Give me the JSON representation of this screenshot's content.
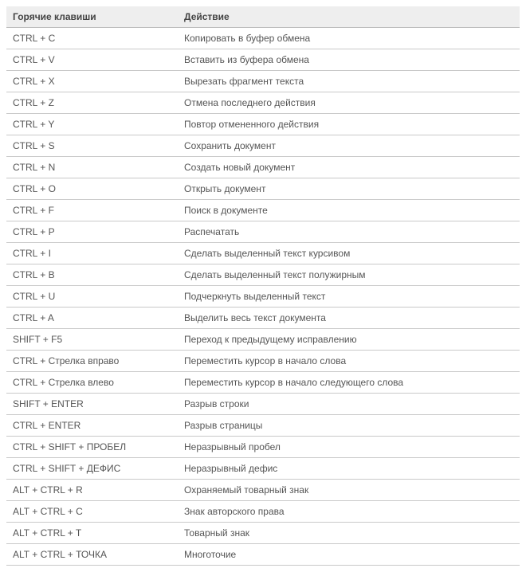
{
  "table": {
    "headers": {
      "hotkey": "Горячие клавиши",
      "action": "Действие"
    },
    "rows": [
      {
        "hotkey": "CTRL + C",
        "action": "Копировать в буфер обмена"
      },
      {
        "hotkey": "CTRL + V",
        "action": "Вставить из буфера обмена"
      },
      {
        "hotkey": "CTRL + X",
        "action": "Вырезать фрагмент текста"
      },
      {
        "hotkey": "CTRL + Z",
        "action": "Отмена последнего действия"
      },
      {
        "hotkey": "CTRL + Y",
        "action": "Повтор отмененного действия"
      },
      {
        "hotkey": "CTRL + S",
        "action": "Сохранить документ"
      },
      {
        "hotkey": "CTRL + N",
        "action": "Создать новый документ"
      },
      {
        "hotkey": "CTRL + O",
        "action": "Открыть документ"
      },
      {
        "hotkey": "CTRL + F",
        "action": "Поиск в документе"
      },
      {
        "hotkey": "CTRL + P",
        "action": "Распечатать"
      },
      {
        "hotkey": "CTRL + I",
        "action": "Сделать выделенный текст курсивом"
      },
      {
        "hotkey": "CTRL + B",
        "action": "Сделать выделенный текст полужирным"
      },
      {
        "hotkey": "CTRL + U",
        "action": "Подчеркнуть выделенный текст"
      },
      {
        "hotkey": "CTRL + A",
        "action": "Выделить весь текст документа"
      },
      {
        "hotkey": "SHIFT + F5",
        "action": "Переход к предыдущему исправлению"
      },
      {
        "hotkey": "CTRL + Стрелка вправо",
        "action": "Переместить курсор в начало слова"
      },
      {
        "hotkey": "CTRL + Стрелка влево",
        "action": "Переместить курсор в начало следующего слова"
      },
      {
        "hotkey": "SHIFT + ENTER",
        "action": "Разрыв строки"
      },
      {
        "hotkey": "CTRL + ENTER",
        "action": "Разрыв страницы"
      },
      {
        "hotkey": "CTRL + SHIFT + ПРОБЕЛ",
        "action": "Неразрывный пробел"
      },
      {
        "hotkey": "CTRL + SHIFT + ДЕФИС",
        "action": "Неразрывный дефис"
      },
      {
        "hotkey": "ALT + CTRL + R",
        "action": "Охраняемый товарный знак"
      },
      {
        "hotkey": "ALT + CTRL + C",
        "action": "Знак авторского права"
      },
      {
        "hotkey": "ALT + CTRL + T",
        "action": "Товарный знак"
      },
      {
        "hotkey": "ALT + CTRL + ТОЧКА",
        "action": "Многоточие"
      }
    ]
  }
}
